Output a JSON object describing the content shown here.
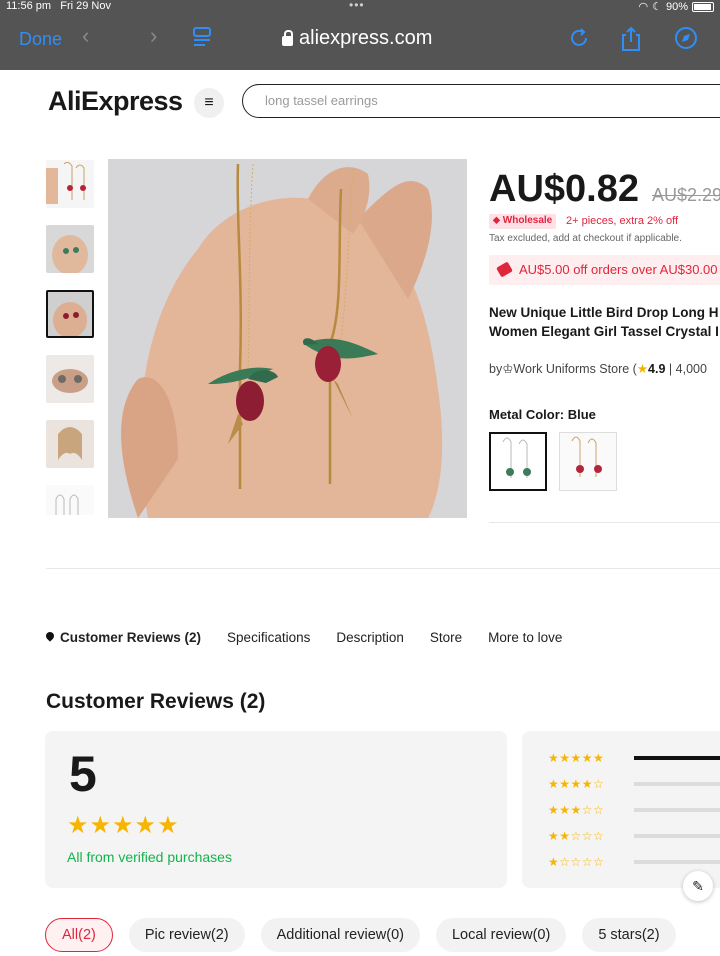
{
  "status_bar": {
    "time": "11:56 pm",
    "date": "Fri 29 Nov",
    "battery": "90%"
  },
  "browser": {
    "done_label": "Done",
    "url": "aliexpress.com"
  },
  "header": {
    "logo": "AliExpress",
    "search_placeholder": "long tassel earrings"
  },
  "product": {
    "price": "AU$0.82",
    "old_price": "AU$2.29",
    "wholesale_badge": "Wholesale",
    "wholesale_text": "2+ pieces, extra 2% off",
    "tax_note": "Tax excluded, add at checkout if applicable.",
    "coupon": "AU$5.00 off orders over AU$30.00",
    "title_line1": "New Unique Little Bird Drop Long H",
    "title_line2": "Women Elegant Girl Tassel Crystal I",
    "store_prefix": "by",
    "store_name": "Work Uniforms Store (",
    "store_rating": "4.9",
    "store_sold": "| 4,000",
    "color_label": "Metal Color: Blue"
  },
  "tabs": [
    "Customer Reviews (2)",
    "Specifications",
    "Description",
    "Store",
    "More to love"
  ],
  "reviews": {
    "title": "Customer Reviews (2)",
    "score": "5",
    "stars": "★★★★★",
    "verified": "All from verified purchases",
    "distribution": [
      {
        "stars": "★★★★★",
        "fraction": 1.0
      },
      {
        "stars": "★★★★☆",
        "fraction": 0.0
      },
      {
        "stars": "★★★☆☆",
        "fraction": 0.0
      },
      {
        "stars": "★★☆☆☆",
        "fraction": 0.0
      },
      {
        "stars": "★☆☆☆☆",
        "fraction": 0.0
      }
    ]
  },
  "filters": [
    "All(2)",
    "Pic review(2)",
    "Additional review(0)",
    "Local review(0)",
    "5 stars(2)"
  ],
  "colors": {
    "accent": "#e0263d",
    "star": "#f7b500",
    "verified": "#13b34b",
    "safari_blue": "#2f8ef7"
  }
}
